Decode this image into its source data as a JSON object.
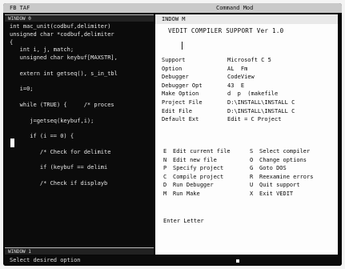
{
  "topbar": {
    "left_text": "FB TAF",
    "right_text": "Command Mod"
  },
  "left_window": {
    "title": "WINDOW 0",
    "bottom_title": "WINDOW 1",
    "code": [
      "int mac_unit(codbuf,delimiter)",
      "unsigned char *codbuf,delimiter",
      "{",
      "   int i, j, match;",
      "   unsigned char keybuf[MAXSTR],",
      "",
      "   extern int getseq(), s_in_tbl",
      "",
      "   i=0;",
      "",
      "   while (TRUE) {     /* proces",
      "",
      "      j=getseq(keybuf,i);",
      "",
      "      if (i == 0) {",
      "",
      "         /* Check for delimite",
      "",
      "         if (keybuf == delimi",
      "",
      "         /* Check if displayb"
    ]
  },
  "right_window": {
    "title": "INDOW M",
    "heading": "VEDIT COMPILER SUPPORT Ver 1.0",
    "settings": [
      {
        "key": "Support",
        "value": "Microsoft C 5"
      },
      {
        "key": "Option",
        "value": "AL  Fm"
      },
      {
        "key": "Debugger",
        "value": "CodeView"
      },
      {
        "key": "Debugger Opt",
        "value": "43  E"
      },
      {
        "key": "Make Option",
        "value": "d  p  (makefile"
      },
      {
        "key": "Project File",
        "value": "D:\\INSTALL\\INSTALL C"
      },
      {
        "key": "Edit File",
        "value": "D:\\INSTALL\\INSTALL C"
      },
      {
        "key": "Default Ext",
        "value": "Edit = C Project"
      }
    ],
    "options": [
      {
        "left_key": "E",
        "left_label": "Edit current file",
        "right_key": "S",
        "right_label": "Select compiler"
      },
      {
        "left_key": "N",
        "left_label": "Edit new file",
        "right_key": "O",
        "right_label": "Change options"
      },
      {
        "left_key": "P",
        "left_label": "Specify project",
        "right_key": "G",
        "right_label": "Goto DOS"
      },
      {
        "left_key": "C",
        "left_label": "Compile project",
        "right_key": "R",
        "right_label": "Reexamine errors"
      },
      {
        "left_key": "D",
        "left_label": "Run Debugger",
        "right_key": "U",
        "right_label": "Quit support"
      },
      {
        "left_key": "M",
        "left_label": "Run Make",
        "right_key": "X",
        "right_label": "Exit VEDIT"
      }
    ],
    "prompt": "Enter Letter"
  },
  "status": {
    "text": "Select desired option"
  }
}
